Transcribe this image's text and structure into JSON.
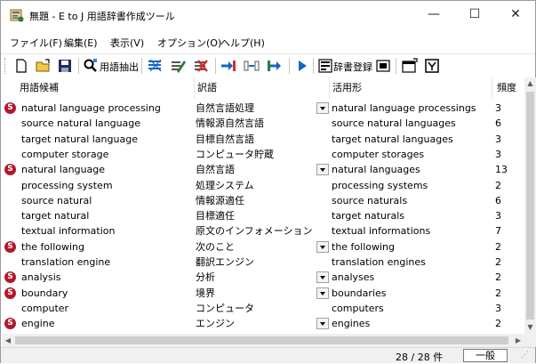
{
  "window": {
    "title": "無題 - E to J 用語辞書作成ツール",
    "minimize_glyph": "—",
    "maximize_glyph": "☐",
    "close_glyph": "✕"
  },
  "menu": [
    "ファイル(F)",
    "編集(E)",
    "表示(V)",
    "オプション(O)",
    "ヘルプ(H)"
  ],
  "toolbar": {
    "extract_label": "用語抽出",
    "register_label": "辞書登録",
    "icons": [
      "new-file-icon",
      "open-folder-icon",
      "save-icon",
      "term-extract-icon",
      "mark-all-icon",
      "edit-mark-icon",
      "clear-mark-icon",
      "insert-left-icon",
      "insert-mid-icon",
      "insert-right-icon",
      "play-icon",
      "dict-register-icon",
      "dict-view-icon",
      "settings-icon",
      "filter-icon"
    ]
  },
  "columns": [
    "用語候補",
    "訳語",
    "活用形",
    "頻度"
  ],
  "rows": [
    {
      "mark": true,
      "term": "natural language processing",
      "translation": "自然言語処理",
      "dropdown": true,
      "inflection": "natural language processings",
      "freq": "3"
    },
    {
      "mark": false,
      "term": "source natural language",
      "translation": "情報源自然言語",
      "dropdown": false,
      "inflection": "source natural languages",
      "freq": "6"
    },
    {
      "mark": false,
      "term": "target natural language",
      "translation": "目標自然言語",
      "dropdown": false,
      "inflection": "target natural languages",
      "freq": "3"
    },
    {
      "mark": false,
      "term": "computer storage",
      "translation": "コンピュータ貯蔵",
      "dropdown": false,
      "inflection": "computer storages",
      "freq": "3"
    },
    {
      "mark": true,
      "term": "natural language",
      "translation": "自然言語",
      "dropdown": true,
      "inflection": "natural languages",
      "freq": "13"
    },
    {
      "mark": false,
      "term": "processing system",
      "translation": "処理システム",
      "dropdown": false,
      "inflection": "processing systems",
      "freq": "2"
    },
    {
      "mark": false,
      "term": "source natural",
      "translation": "情報源適任",
      "dropdown": false,
      "inflection": "source naturals",
      "freq": "6"
    },
    {
      "mark": false,
      "term": "target natural",
      "translation": "目標適任",
      "dropdown": false,
      "inflection": "target naturals",
      "freq": "3"
    },
    {
      "mark": false,
      "term": "textual information",
      "translation": "原文のインフォメーション",
      "dropdown": false,
      "inflection": "textual informations",
      "freq": "7"
    },
    {
      "mark": true,
      "term": "the following",
      "translation": "次のこと",
      "dropdown": true,
      "inflection": "the following",
      "freq": "2"
    },
    {
      "mark": false,
      "term": "translation engine",
      "translation": "翻訳エンジン",
      "dropdown": false,
      "inflection": "translation engines",
      "freq": "2"
    },
    {
      "mark": true,
      "term": "analysis",
      "translation": "分析",
      "dropdown": true,
      "inflection": "analyses",
      "freq": "2"
    },
    {
      "mark": true,
      "term": "boundary",
      "translation": "境界",
      "dropdown": true,
      "inflection": "boundaries",
      "freq": "2"
    },
    {
      "mark": false,
      "term": "computer",
      "translation": "コンピュータ",
      "dropdown": false,
      "inflection": "computers",
      "freq": "3"
    },
    {
      "mark": true,
      "term": "engine",
      "translation": "エンジン",
      "dropdown": true,
      "inflection": "engines",
      "freq": "2"
    }
  ],
  "mark_glyph": "S",
  "status": {
    "count": "28 / 28 件",
    "mode": "一般"
  },
  "colors": {
    "mark": "#b2182b",
    "blue_arrow": "#1565c0",
    "red_icon": "#d32f2f"
  }
}
